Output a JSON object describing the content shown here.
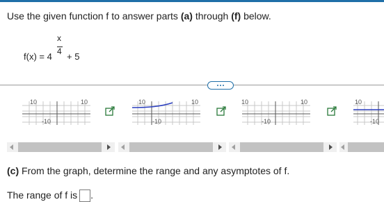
{
  "instructions": {
    "text_before": "Use the given function f to answer parts ",
    "part_a": "(a)",
    "text_middle": " through ",
    "part_f": "(f)",
    "text_after": " below."
  },
  "function": {
    "lhs": "f(x) = 4",
    "exp_numerator": "x",
    "exp_denominator": "4",
    "tail": "+ 5"
  },
  "more_button": {
    "icon": "ellipsis-icon"
  },
  "graphs": {
    "tick_top": "10",
    "tick_bottom": "-10",
    "curve_color": "#2b3fbf",
    "expand_icon": "expand-icon"
  },
  "part_c": {
    "label": "(c)",
    "text": " From the graph, determine the range and any asymptotes of f."
  },
  "range": {
    "label": "The range of f is",
    "trailing": "."
  }
}
